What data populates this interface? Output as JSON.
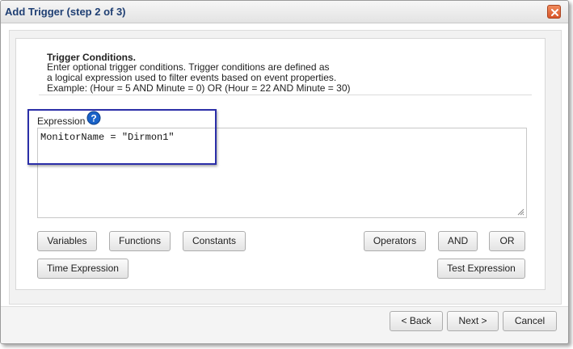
{
  "window": {
    "title": "Add Trigger (step 2 of 3)"
  },
  "conditions": {
    "heading": "Trigger Conditions.",
    "line1": "Enter optional trigger conditions. Trigger conditions are defined as",
    "line2": "a logical expression used to filter events based on event properties.",
    "line3": "Example: (Hour = 5 AND Minute = 0) OR (Hour = 22 AND Minute = 30)"
  },
  "expression": {
    "label": "Expression",
    "value": "MonitorName = \"Dirmon1\""
  },
  "buttons": {
    "variables": "Variables",
    "functions": "Functions",
    "constants": "Constants",
    "operators": "Operators",
    "and": "AND",
    "or": "OR",
    "time_expression": "Time Expression",
    "test_expression": "Test Expression"
  },
  "footer": {
    "back": "< Back",
    "next": "Next >",
    "cancel": "Cancel"
  },
  "colors": {
    "title_text": "#1f3f73",
    "close_button": "#d8552a",
    "highlight_border": "#2b2ea8",
    "help_icon": "#1a63c9"
  }
}
